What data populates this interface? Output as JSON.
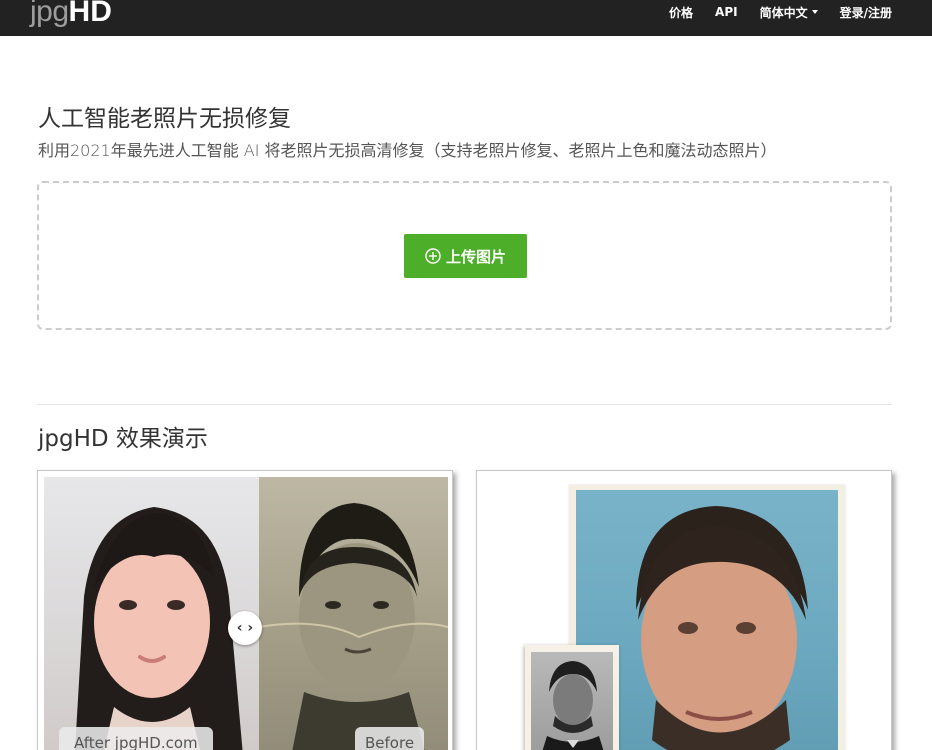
{
  "nav": {
    "logo_light": "jpg",
    "logo_bold": "HD",
    "links": {
      "pricing": "价格",
      "api": "API",
      "language": "简体中文",
      "login": "登录/注册"
    }
  },
  "hero": {
    "title": "人工智能老照片无损修复",
    "subtitle": "利用2021年最先进人工智能 AI 将老照片无损高清修复（支持老照片修复、老照片上色和魔法动态照片）",
    "upload_label": "上传图片"
  },
  "demo": {
    "title": "jpgHD 效果演示",
    "after_label": "After jpgHD.com",
    "before_label": "Before",
    "handle_glyph": "‹ ›"
  },
  "colors": {
    "navbar": "#222222",
    "upload_button": "#4cae29"
  }
}
